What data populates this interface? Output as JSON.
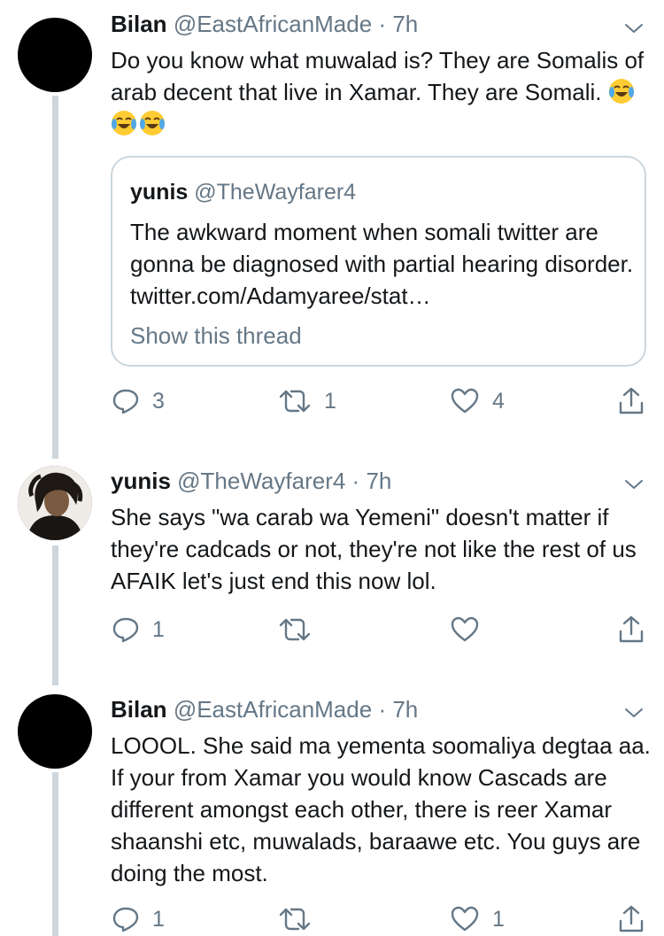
{
  "tweets": [
    {
      "name": "Bilan",
      "handle": "@EastAfricanMade",
      "time": "7h",
      "text": "Do you know what muwalad is? They are Somalis of arab decent that live in Xamar. They are Somali.",
      "emoji": [
        "joy-emoji",
        "joy-emoji",
        "joy-emoji"
      ],
      "quote": {
        "name": "yunis",
        "handle": "@TheWayfarer4",
        "text": "The awkward moment when somali twitter are gonna be diagnosed with partial hearing disorder. twitter.com/Adamyaree/stat…",
        "show_thread": "Show this thread"
      },
      "replies": "3",
      "retweets": "1",
      "likes": "4"
    },
    {
      "name": "yunis",
      "handle": "@TheWayfarer4",
      "time": "7h",
      "text": "She says \"wa carab wa Yemeni\" doesn't matter if they're cadcads or not, they're not like the rest of us AFAIK let's just end this now lol.",
      "replies": "1",
      "retweets": "",
      "likes": ""
    },
    {
      "name": "Bilan",
      "handle": "@EastAfricanMade",
      "time": "7h",
      "text": "LOOOL. She said ma yementa soomaliya degtaa aa. If your from Xamar you would know Cascads are different amongst each other, there is reer Xamar shaanshi etc, muwalads, baraawe etc. You guys are doing the most.",
      "replies": "1",
      "retweets": "",
      "likes": "1"
    }
  ],
  "separator": "·",
  "colors": {
    "text": "#14171a",
    "secondary": "#657786",
    "thread_line": "#cdd6dd",
    "border": "#ccd6dd"
  }
}
